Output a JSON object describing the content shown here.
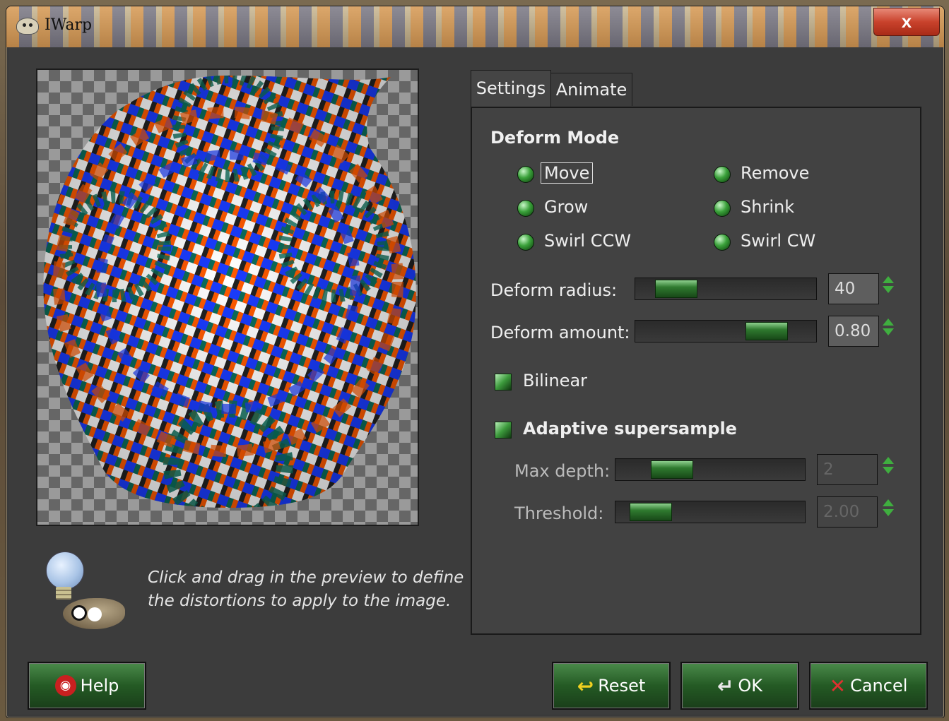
{
  "window": {
    "title": "IWarp",
    "close_symbol": "x"
  },
  "hint": {
    "line1": "Click and drag in the preview to define",
    "line2": "the distortions to apply to the image."
  },
  "tabs": [
    {
      "label": "Settings"
    },
    {
      "label": "Animate"
    }
  ],
  "deform_mode": {
    "title": "Deform Mode",
    "options": [
      {
        "label": "Move",
        "selected": true
      },
      {
        "label": "Remove",
        "selected": false
      },
      {
        "label": "Grow",
        "selected": false
      },
      {
        "label": "Shrink",
        "selected": false
      },
      {
        "label": "Swirl CCW",
        "selected": false
      },
      {
        "label": "Swirl CW",
        "selected": false
      }
    ]
  },
  "deform_radius": {
    "label": "Deform radius:",
    "value": "40",
    "fraction": 0.16
  },
  "deform_amount": {
    "label": "Deform amount:",
    "value": "0.80",
    "fraction": 0.78
  },
  "bilinear": {
    "label": "Bilinear",
    "checked": true
  },
  "adaptive": {
    "label": "Adaptive supersample",
    "checked": true
  },
  "max_depth": {
    "label": "Max depth:",
    "value": "2",
    "fraction": 0.2
  },
  "threshold": {
    "label": "Threshold:",
    "value": "2.00",
    "fraction": 0.08
  },
  "buttons": {
    "help": "Help",
    "reset": "Reset",
    "ok": "OK",
    "cancel": "Cancel"
  },
  "colors": {
    "accent_green": "#2f7a2f",
    "panel": "#424242",
    "pattern_orange": "#ff5a00",
    "pattern_blue": "#1a3cff",
    "pattern_teal": "#0c6e5a"
  }
}
